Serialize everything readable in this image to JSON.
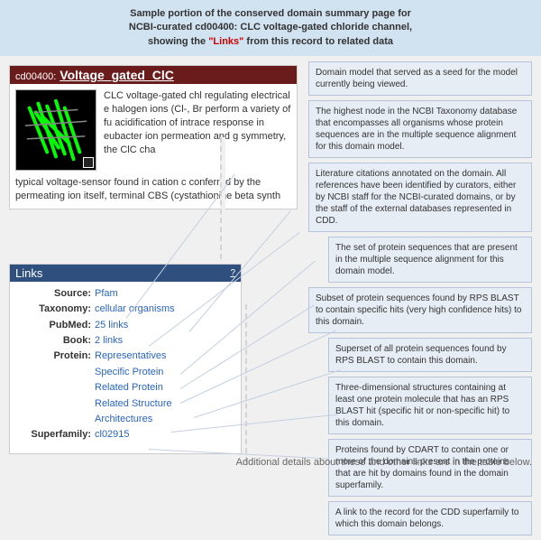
{
  "header": {
    "line1": "Sample portion of the conserved domain summary page for",
    "line2": "NCBI-curated cd00400: CLC voltage-gated chloride channel,",
    "line3_prefix": "showing the ",
    "line3_links_word": "\"Links\"",
    "line3_suffix": " from this record to related data"
  },
  "domain": {
    "accession": "cd00400:",
    "name": "Voltage_gated_ClC",
    "desc_right": "CLC voltage-gated chl regulating electrical e halogen ions (Cl-, Br perform a variety of fu acidification of intrace response in eubacter ion permeation and g symmetry, the ClC cha",
    "desc_cont": "typical voltage-sensor found in cation c conferred by the permeating ion itself, terminal CBS (cystathionine beta synth"
  },
  "links": {
    "title": "Links",
    "help": "?",
    "rows": {
      "source": {
        "label": "Source:",
        "value": "Pfam"
      },
      "taxonomy": {
        "label": "Taxonomy:",
        "value": "cellular organisms"
      },
      "pubmed": {
        "label": "PubMed:",
        "value": "25 links"
      },
      "book": {
        "label": "Book:",
        "value": "2 links"
      },
      "protein": {
        "label": "Protein:"
      },
      "protein_values": [
        "Representatives",
        "Specific Protein",
        "Related Protein",
        "Related Structure",
        "Architectures"
      ],
      "superfamily": {
        "label": "Superfamily:",
        "value": "cl02915"
      }
    }
  },
  "annots": [
    "Domain model that served as a seed for the model currently being viewed.",
    "The highest node in the NCBI Taxonomy database that encompasses all organisms whose protein sequences are in the multiple sequence alignment for this domain model.",
    "Literature citations annotated on the domain. All references have been identified by curators, either by NCBI staff for the NCBI-curated domains, or by the staff of the external databases represented in CDD.",
    "The set of protein sequences that are present in the multiple sequence alignment for this domain model.",
    "Subset of protein sequences found by RPS BLAST to contain specific hits (very high confidence hits) to this domain.",
    "Superset of all protein sequences found by RPS BLAST to contain this domain.",
    "Three-dimensional structures containing at least one protein molecule that has an RPS BLAST hit (specific hit or non-specific hit) to this domain.",
    "Proteins found by CDART to contain one or more of the domains present in the proteins that are hit by domains found in the domain superfamily.",
    "A link to the record for the CDD superfamily to which this domain belongs."
  ],
  "footnote": "Additional details about these and other links are in the table below."
}
